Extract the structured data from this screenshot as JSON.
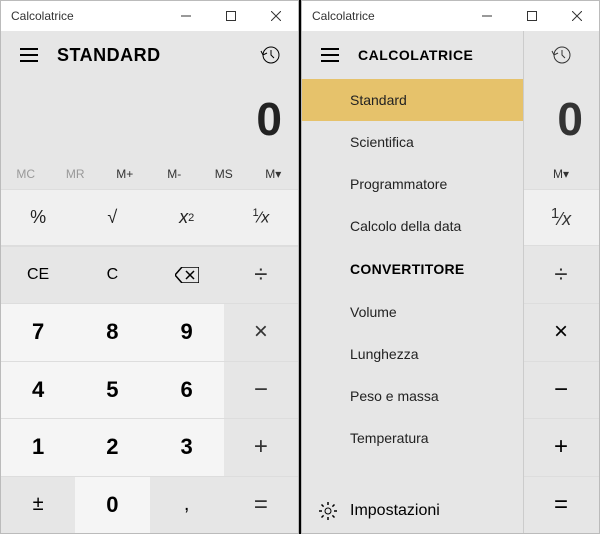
{
  "left": {
    "title": "Calcolatrice",
    "mode": "STANDARD",
    "display": "0",
    "memory": [
      "MC",
      "MR",
      "M+",
      "M-",
      "MS",
      "M▾"
    ],
    "funcs": [
      "%",
      "√",
      "x²",
      "¹⁄ₓ"
    ],
    "oprow": [
      "CE",
      "C",
      "⌫",
      "÷"
    ],
    "keys": [
      [
        "7",
        "8",
        "9",
        "×"
      ],
      [
        "4",
        "5",
        "6",
        "−"
      ],
      [
        "1",
        "2",
        "3",
        "+"
      ],
      [
        "±",
        "0",
        ",",
        "="
      ]
    ]
  },
  "right": {
    "title": "Calcolatrice",
    "section1": "CALCOLATRICE",
    "items1": [
      "Standard",
      "Scientifica",
      "Programmatore",
      "Calcolo della data"
    ],
    "selected": "Standard",
    "section2": "CONVERTITORE",
    "items2": [
      "Volume",
      "Lunghezza",
      "Peso e massa",
      "Temperatura"
    ],
    "settings": "Impostazioni",
    "display": "0",
    "mem": "M▾",
    "func": "¹⁄ₓ",
    "ops": [
      "÷",
      "×",
      "−",
      "+",
      "="
    ]
  }
}
